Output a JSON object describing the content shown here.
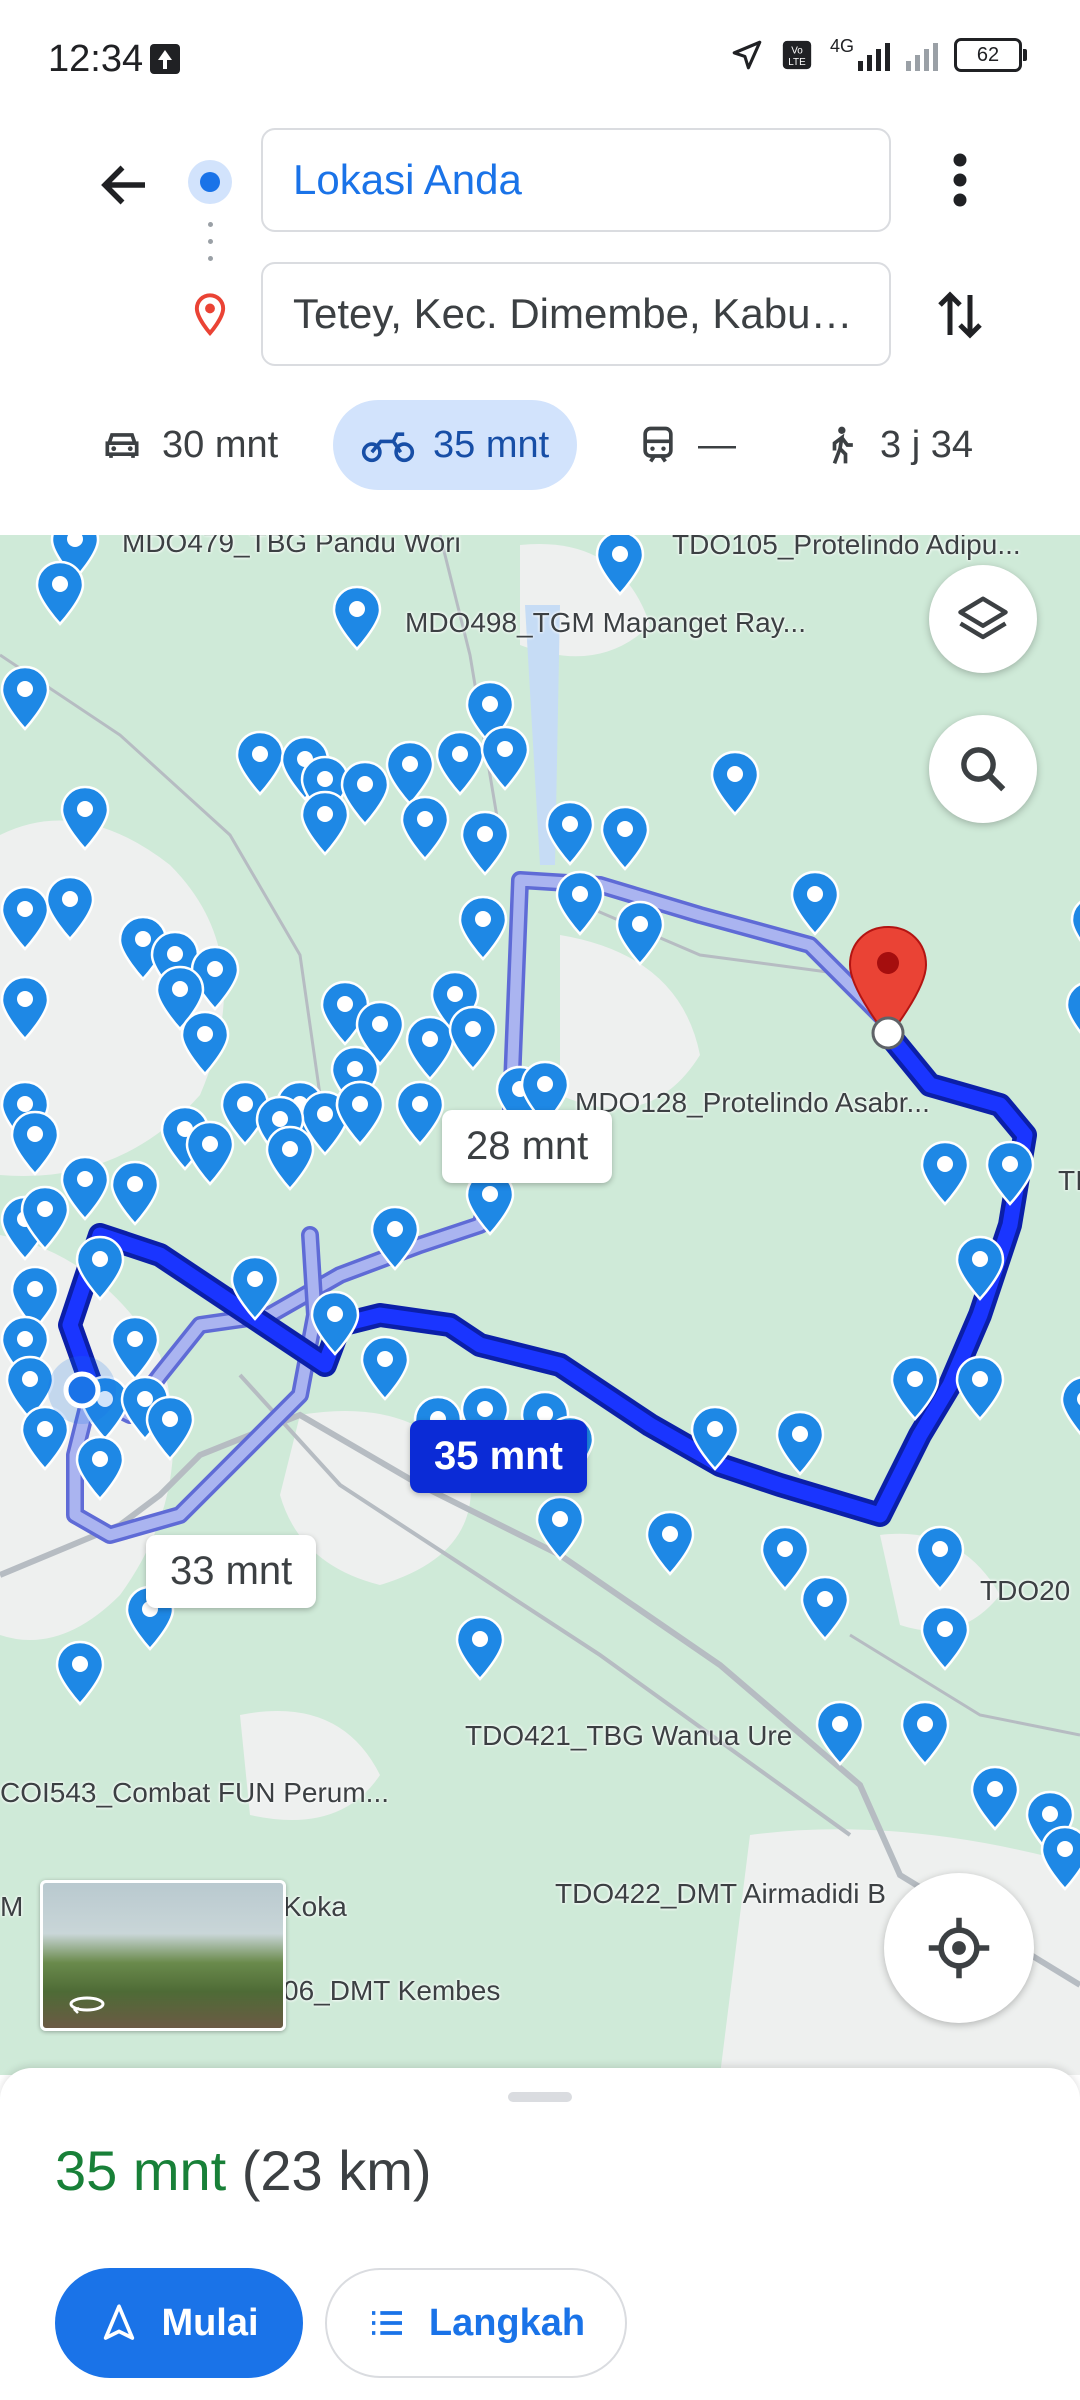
{
  "status_bar": {
    "time": "12:34",
    "network": "4G",
    "battery": "62"
  },
  "header": {
    "origin_value": "Lokasi Anda",
    "destination_value": "Tetey, Kec. Dimembe, Kabupaten Minahasa Utara",
    "modes": [
      {
        "name": "car",
        "label": "30 mnt",
        "icon": "car-icon"
      },
      {
        "name": "motorcycle",
        "label": "35 mnt",
        "icon": "motorcycle-icon",
        "selected": true
      },
      {
        "name": "transit",
        "label": "—",
        "icon": "train-icon"
      },
      {
        "name": "walk",
        "label": "3 j 34",
        "icon": "walk-icon"
      }
    ]
  },
  "map": {
    "labels": {
      "mdo479": "MDO479_TBG Pandu Wori",
      "tdo105": "TDO105_Protelindo Adipu...",
      "mdo498": "MDO498_TGM Mapanget Ray...",
      "mdo128": "MDO128_Protelindo Asabr...",
      "tdo209": "TDO20",
      "tdo_edge": "TI",
      "tdo421": "TDO421_TBG Wanua Ure",
      "coi543": "COI543_Combat FUN Perum...",
      "koka": "Koka",
      "tdo422": "TDO422_DMT Airmadidi B",
      "kembes": "06_DMT Kembes",
      "m_edge": "M"
    },
    "routes": {
      "alt1_time": "28 mnt",
      "selected_time": "35 mnt",
      "alt2_time": "33 mnt"
    },
    "route_color": "#0b2bd6",
    "alt_route_color": "#aab4f0",
    "pin_color": "#1e88e5",
    "destination_color": "#ea4335"
  },
  "sheet": {
    "duration": "35 mnt",
    "distance": "(23 km)",
    "start_label": "Mulai",
    "steps_label": "Langkah"
  }
}
